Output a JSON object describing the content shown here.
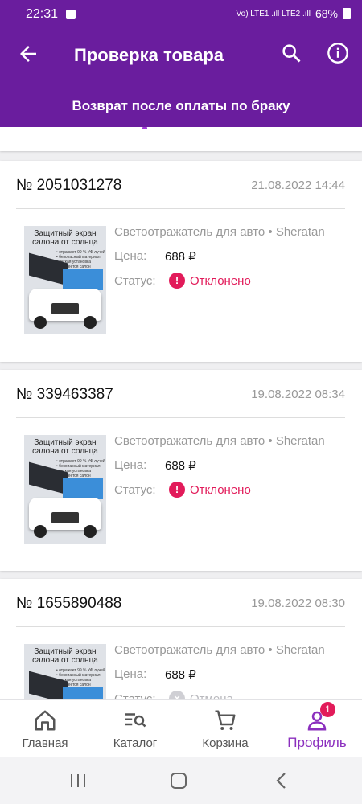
{
  "status_bar": {
    "time": "22:31",
    "signal": "Vo) LTE1 .ıll  LTE2 .ıll",
    "battery": "68%"
  },
  "app_bar": {
    "title": "Проверка товара"
  },
  "sub_bar": {
    "text": "Возврат после оплаты по браку"
  },
  "orders": [
    {
      "number": "№ 2051031278",
      "date": "21.08.2022 14:44",
      "product": "Светоотражатель для авто • Sheratan",
      "price_label": "Цена:",
      "price": "688 ₽",
      "status_label": "Статус:",
      "status": "Отклонено",
      "status_icon": "!",
      "status_type": "rejected"
    },
    {
      "number": "№ 339463387",
      "date": "19.08.2022 08:34",
      "product": "Светоотражатель для авто • Sheratan",
      "price_label": "Цена:",
      "price": "688 ₽",
      "status_label": "Статус:",
      "status": "Отклонено",
      "status_icon": "!",
      "status_type": "rejected"
    },
    {
      "number": "№ 1655890488",
      "date": "19.08.2022 08:30",
      "product": "Светоотражатель для авто • Sheratan",
      "price_label": "Цена:",
      "price": "688 ₽",
      "status_label": "Статус:",
      "status": "Отмена",
      "status_icon": "×",
      "status_type": "cancelled"
    }
  ],
  "product_image": {
    "title": "Защитный экран салона от солнца",
    "bullets": [
      "• отражает 99 % УФ лучей",
      "• безопасный материал",
      "• легкая установка",
      "• не греется салон"
    ]
  },
  "bottom_nav": [
    {
      "label": "Главная",
      "icon": "home-icon"
    },
    {
      "label": "Каталог",
      "icon": "catalog-icon"
    },
    {
      "label": "Корзина",
      "icon": "cart-icon"
    },
    {
      "label": "Профиль",
      "icon": "profile-icon",
      "active": true
    }
  ],
  "profile_badge": "1",
  "colors": {
    "brand": "#6a1d9e",
    "accent": "#8b2fbe",
    "rejected": "#e21b5a",
    "muted": "#999999"
  }
}
